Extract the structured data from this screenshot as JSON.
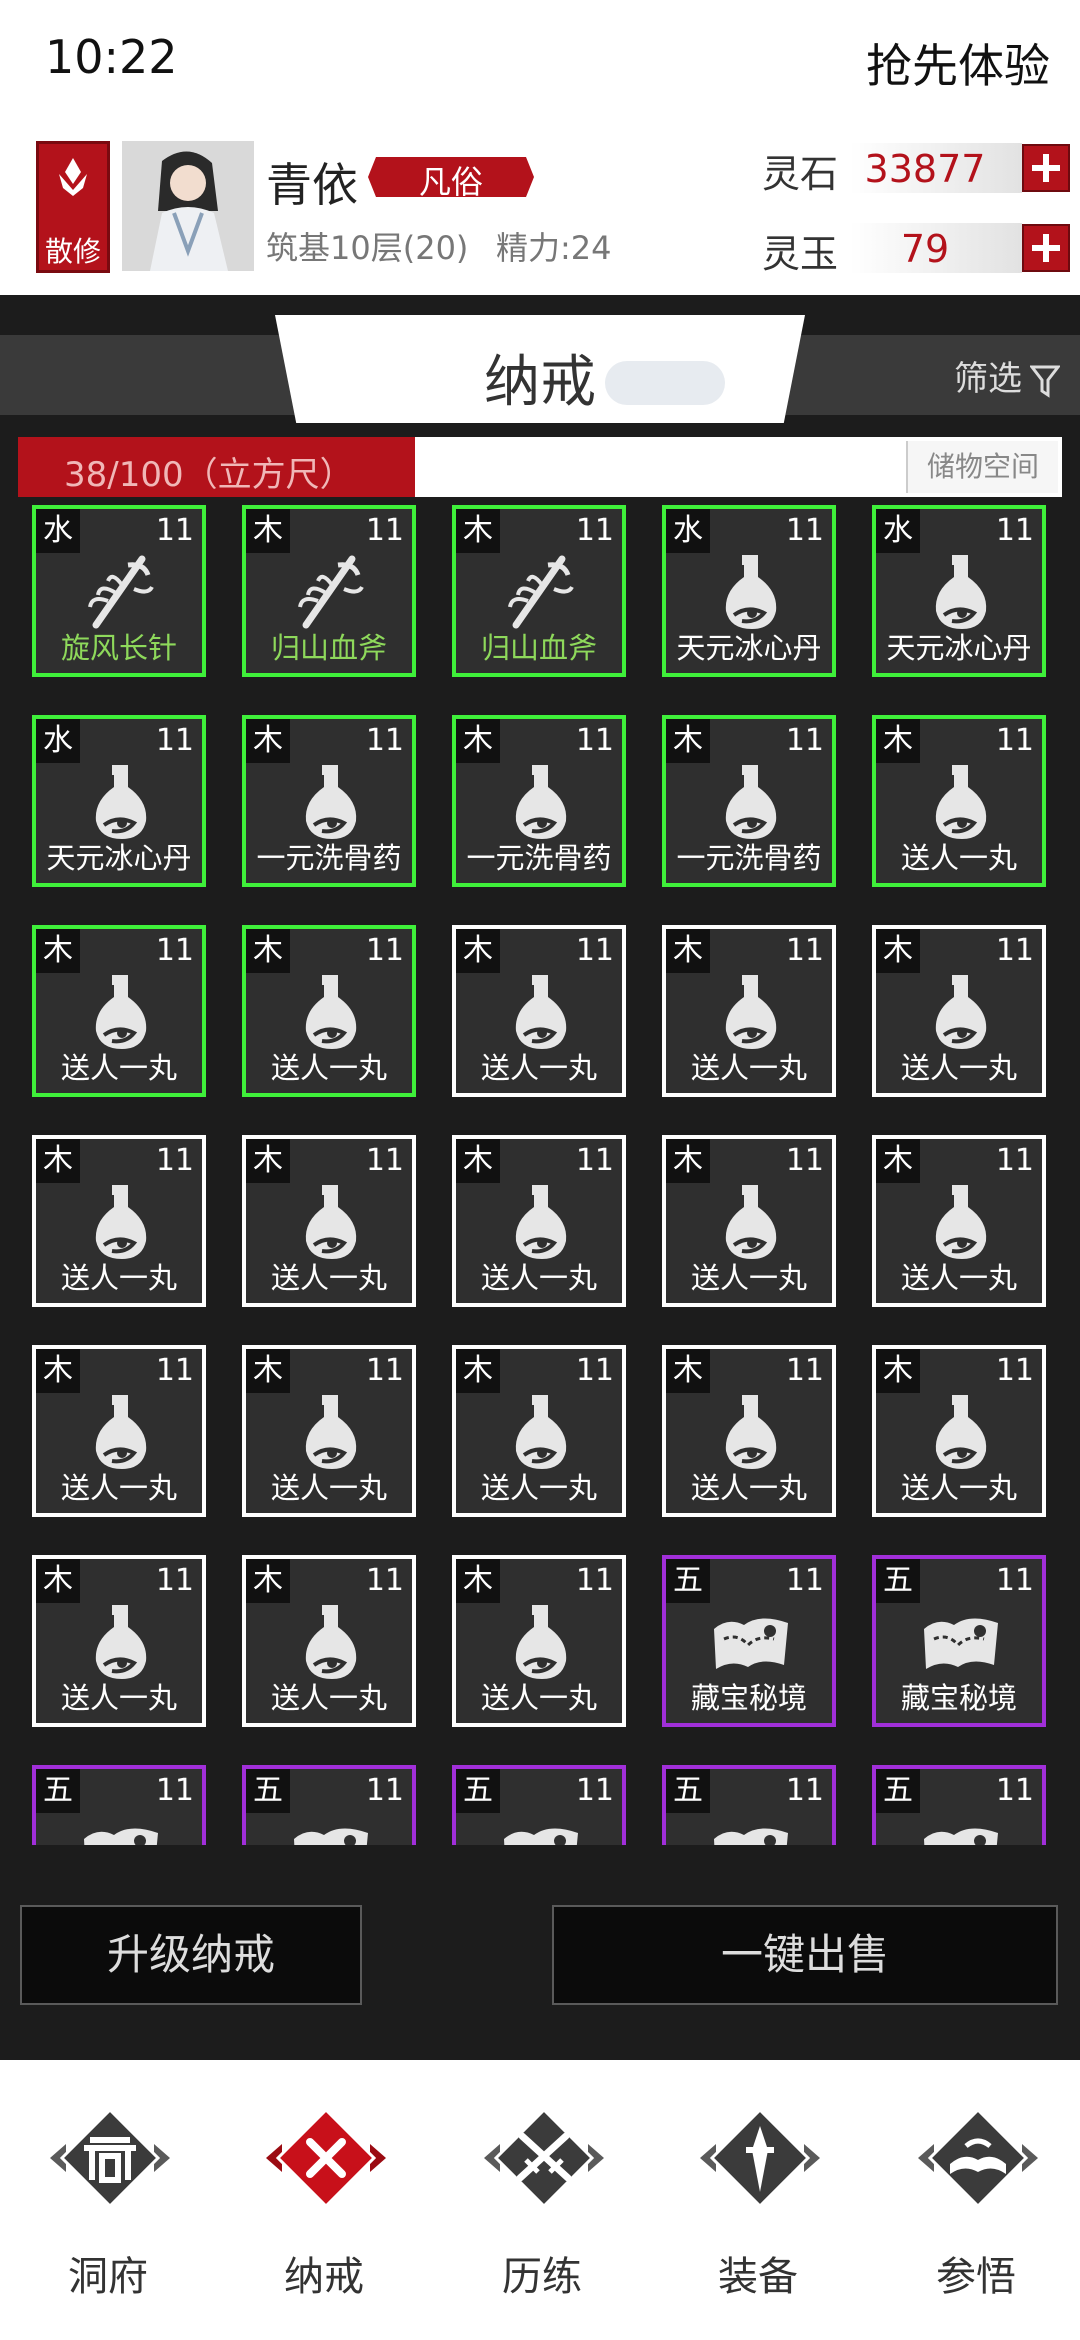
{
  "status": {
    "time": "10:22",
    "trial": "抢先体验"
  },
  "player": {
    "sect": "散修",
    "name": "青依",
    "rank": "凡俗",
    "realm": "筑基10层(20)",
    "energy": "精力:24"
  },
  "currency": [
    {
      "label": "灵石",
      "value": "33877"
    },
    {
      "label": "灵玉",
      "value": "79"
    }
  ],
  "colors": {
    "accent": "#b3121b",
    "green": "#3ff03a",
    "purple": "#a12fd9",
    "panel": "#1c1c1c"
  },
  "panel": {
    "tab": "纳戒",
    "filter": "筛选",
    "capacity": {
      "text": "38/100（立方尺）",
      "used": 38,
      "total": 100
    },
    "storage": "储物空间"
  },
  "items": [
    {
      "elem": "水",
      "lvl": "11",
      "name": "旋风长针",
      "icon": "weapon-icon",
      "rarity": "green"
    },
    {
      "elem": "木",
      "lvl": "11",
      "name": "归山血斧",
      "icon": "weapon-icon",
      "rarity": "green"
    },
    {
      "elem": "木",
      "lvl": "11",
      "name": "归山血斧",
      "icon": "weapon-icon",
      "rarity": "green"
    },
    {
      "elem": "水",
      "lvl": "11",
      "name": "天元冰心丹",
      "icon": "pill-bottle-icon",
      "rarity": "green"
    },
    {
      "elem": "水",
      "lvl": "11",
      "name": "天元冰心丹",
      "icon": "pill-bottle-icon",
      "rarity": "green"
    },
    {
      "elem": "水",
      "lvl": "11",
      "name": "天元冰心丹",
      "icon": "pill-bottle-icon",
      "rarity": "green"
    },
    {
      "elem": "木",
      "lvl": "11",
      "name": "一元洗骨药",
      "icon": "pill-bottle-icon",
      "rarity": "green"
    },
    {
      "elem": "木",
      "lvl": "11",
      "name": "一元洗骨药",
      "icon": "pill-bottle-icon",
      "rarity": "green"
    },
    {
      "elem": "木",
      "lvl": "11",
      "name": "一元洗骨药",
      "icon": "pill-bottle-icon",
      "rarity": "green"
    },
    {
      "elem": "木",
      "lvl": "11",
      "name": "送人一丸",
      "icon": "pill-bottle-icon",
      "rarity": "green"
    },
    {
      "elem": "木",
      "lvl": "11",
      "name": "送人一丸",
      "icon": "pill-bottle-icon",
      "rarity": "green"
    },
    {
      "elem": "木",
      "lvl": "11",
      "name": "送人一丸",
      "icon": "pill-bottle-icon",
      "rarity": "green"
    },
    {
      "elem": "木",
      "lvl": "11",
      "name": "送人一丸",
      "icon": "pill-bottle-icon",
      "rarity": "white"
    },
    {
      "elem": "木",
      "lvl": "11",
      "name": "送人一丸",
      "icon": "pill-bottle-icon",
      "rarity": "white"
    },
    {
      "elem": "木",
      "lvl": "11",
      "name": "送人一丸",
      "icon": "pill-bottle-icon",
      "rarity": "white"
    },
    {
      "elem": "木",
      "lvl": "11",
      "name": "送人一丸",
      "icon": "pill-bottle-icon",
      "rarity": "white"
    },
    {
      "elem": "木",
      "lvl": "11",
      "name": "送人一丸",
      "icon": "pill-bottle-icon",
      "rarity": "white"
    },
    {
      "elem": "木",
      "lvl": "11",
      "name": "送人一丸",
      "icon": "pill-bottle-icon",
      "rarity": "white"
    },
    {
      "elem": "木",
      "lvl": "11",
      "name": "送人一丸",
      "icon": "pill-bottle-icon",
      "rarity": "white"
    },
    {
      "elem": "木",
      "lvl": "11",
      "name": "送人一丸",
      "icon": "pill-bottle-icon",
      "rarity": "white"
    },
    {
      "elem": "木",
      "lvl": "11",
      "name": "送人一丸",
      "icon": "pill-bottle-icon",
      "rarity": "white"
    },
    {
      "elem": "木",
      "lvl": "11",
      "name": "送人一丸",
      "icon": "pill-bottle-icon",
      "rarity": "white"
    },
    {
      "elem": "木",
      "lvl": "11",
      "name": "送人一丸",
      "icon": "pill-bottle-icon",
      "rarity": "white"
    },
    {
      "elem": "木",
      "lvl": "11",
      "name": "送人一丸",
      "icon": "pill-bottle-icon",
      "rarity": "white"
    },
    {
      "elem": "木",
      "lvl": "11",
      "name": "送人一丸",
      "icon": "pill-bottle-icon",
      "rarity": "white"
    },
    {
      "elem": "木",
      "lvl": "11",
      "name": "送人一丸",
      "icon": "pill-bottle-icon",
      "rarity": "white"
    },
    {
      "elem": "木",
      "lvl": "11",
      "name": "送人一丸",
      "icon": "pill-bottle-icon",
      "rarity": "white"
    },
    {
      "elem": "木",
      "lvl": "11",
      "name": "送人一丸",
      "icon": "pill-bottle-icon",
      "rarity": "white"
    },
    {
      "elem": "五",
      "lvl": "11",
      "name": "藏宝秘境",
      "icon": "treasure-map-icon",
      "rarity": "purple"
    },
    {
      "elem": "五",
      "lvl": "11",
      "name": "藏宝秘境",
      "icon": "treasure-map-icon",
      "rarity": "purple"
    },
    {
      "elem": "五",
      "lvl": "11",
      "name": "",
      "icon": "treasure-map-icon",
      "rarity": "purple"
    },
    {
      "elem": "五",
      "lvl": "11",
      "name": "",
      "icon": "treasure-map-icon",
      "rarity": "purple"
    },
    {
      "elem": "五",
      "lvl": "11",
      "name": "",
      "icon": "treasure-map-icon",
      "rarity": "purple"
    },
    {
      "elem": "五",
      "lvl": "11",
      "name": "",
      "icon": "treasure-map-icon",
      "rarity": "purple"
    },
    {
      "elem": "五",
      "lvl": "11",
      "name": "",
      "icon": "treasure-map-icon",
      "rarity": "purple"
    }
  ],
  "actions": {
    "upgrade": "升级纳戒",
    "sell_all": "一键出售"
  },
  "nav": [
    {
      "label": "洞府",
      "icon": "gate-icon",
      "active": false
    },
    {
      "label": "纳戒",
      "icon": "ring-icon",
      "active": true
    },
    {
      "label": "历练",
      "icon": "crossed-swords-icon",
      "active": false
    },
    {
      "label": "装备",
      "icon": "dagger-icon",
      "active": false
    },
    {
      "label": "参悟",
      "icon": "book-icon",
      "active": false
    }
  ]
}
